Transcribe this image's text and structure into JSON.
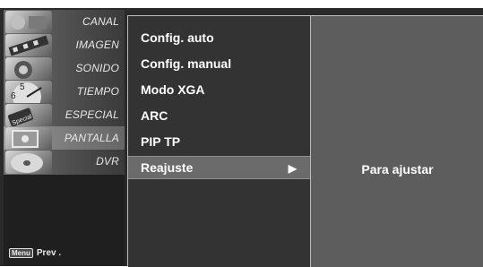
{
  "sidebar": {
    "items": [
      {
        "label": "CANAL",
        "icon": "channel-tuner-icon"
      },
      {
        "label": "IMAGEN",
        "icon": "picture-film-icon"
      },
      {
        "label": "SONIDO",
        "icon": "sound-speaker-icon"
      },
      {
        "label": "TIEMPO",
        "icon": "time-clock-icon"
      },
      {
        "label": "ESPECIAL",
        "icon": "special-tag-icon"
      },
      {
        "label": "PANTALLA",
        "icon": "screen-display-icon"
      },
      {
        "label": "DVR",
        "icon": "dvr-disc-icon"
      }
    ],
    "active_index": 5,
    "footer": {
      "key_label": "Menu",
      "action_label": "Prev ."
    }
  },
  "submenu": {
    "items": [
      {
        "label": "Config. auto"
      },
      {
        "label": "Config. manual"
      },
      {
        "label": "Modo XGA"
      },
      {
        "label": "ARC"
      },
      {
        "label": "PIP TP"
      },
      {
        "label": "Reajuste",
        "arrow": "▶"
      }
    ],
    "selected_index": 5
  },
  "detail": {
    "hint": "Para ajustar"
  }
}
